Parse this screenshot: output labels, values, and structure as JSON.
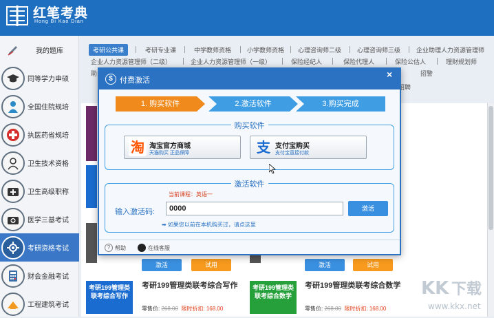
{
  "header": {
    "logo_cn": "红笔考典",
    "logo_en": "Hong Bi Kao Dian"
  },
  "sidebar": {
    "items": [
      {
        "label": "我的题库",
        "icon": "pencil-icon"
      },
      {
        "label": "同等学力申硕",
        "icon": "graduation-cap-icon"
      },
      {
        "label": "全国住院规培",
        "icon": "doctor-icon"
      },
      {
        "label": "执医药省规培",
        "icon": "medical-cross-icon"
      },
      {
        "label": "卫生技术资格",
        "icon": "nurse-icon"
      },
      {
        "label": "卫生高级职称",
        "icon": "first-aid-kit-icon"
      },
      {
        "label": "医学三基考试",
        "icon": "medical-bag-icon"
      },
      {
        "label": "考研资格考试",
        "icon": "gear-network-icon"
      },
      {
        "label": "财会金融考试",
        "icon": "calculator-icon"
      },
      {
        "label": "工程建筑考试",
        "icon": "building-icon"
      }
    ]
  },
  "tabs": {
    "row1": [
      "考研公共课",
      "考研专业课",
      "中学教师资格",
      "小学教师资格",
      "心理咨询师二级",
      "心理咨询师三级",
      "企业助理人力资源管理师"
    ],
    "row2": [
      "企业人力资源管理师（二级）",
      "企业人力资源管理师（一级）",
      "保险经纪人",
      "保险代理人",
      "保险公估人",
      "理财规划师"
    ],
    "row3_left": "助",
    "row3_right": "招警",
    "row3_extra": "招聘"
  },
  "cards": {
    "activate_label": "激活",
    "trial_label": "试用",
    "items": [
      {
        "tile": "考研199管理类联考综合写作",
        "title": "考研199管理类联考综合写作",
        "retail_label": "零售价:",
        "retail": "268.00",
        "sale_label": "限时折扣:",
        "sale": "168.00"
      },
      {
        "tile": "考研199管理类联考综合数学",
        "title": "考研199管理类联考综合数学",
        "retail_label": "零售价:",
        "retail": "268.00",
        "sale_label": "限时折扣:",
        "sale": "168.00"
      }
    ]
  },
  "modal": {
    "title": "付费激活",
    "close": "×",
    "steps": [
      "1. 购买软件",
      "2.激活软件",
      "3.购买完成"
    ],
    "buy_section": "购买软件",
    "taobao": {
      "main": "淘宝官方商城",
      "sub": "天猫购买 正品保障"
    },
    "alipay": {
      "main": "支付宝购买",
      "sub": "支付宝直接付款"
    },
    "activate_section": "激活软件",
    "current_course": "当前课程：英语一",
    "code_label": "输入激活码:",
    "code_value": "0000",
    "activate_button": "激活",
    "hint": "如果您以前在本机购买过，请点这里",
    "help": "帮助",
    "online_service": "在线客服"
  },
  "colors": {
    "header_blue": "#1e6fc0",
    "accent_blue": "#3a90e0",
    "step_orange": "#f08a1c",
    "trial_orange": "#f79a1d",
    "price_red": "#e03b17",
    "tile_blue": "#1a6cd0",
    "tile_green": "#25a03a"
  }
}
